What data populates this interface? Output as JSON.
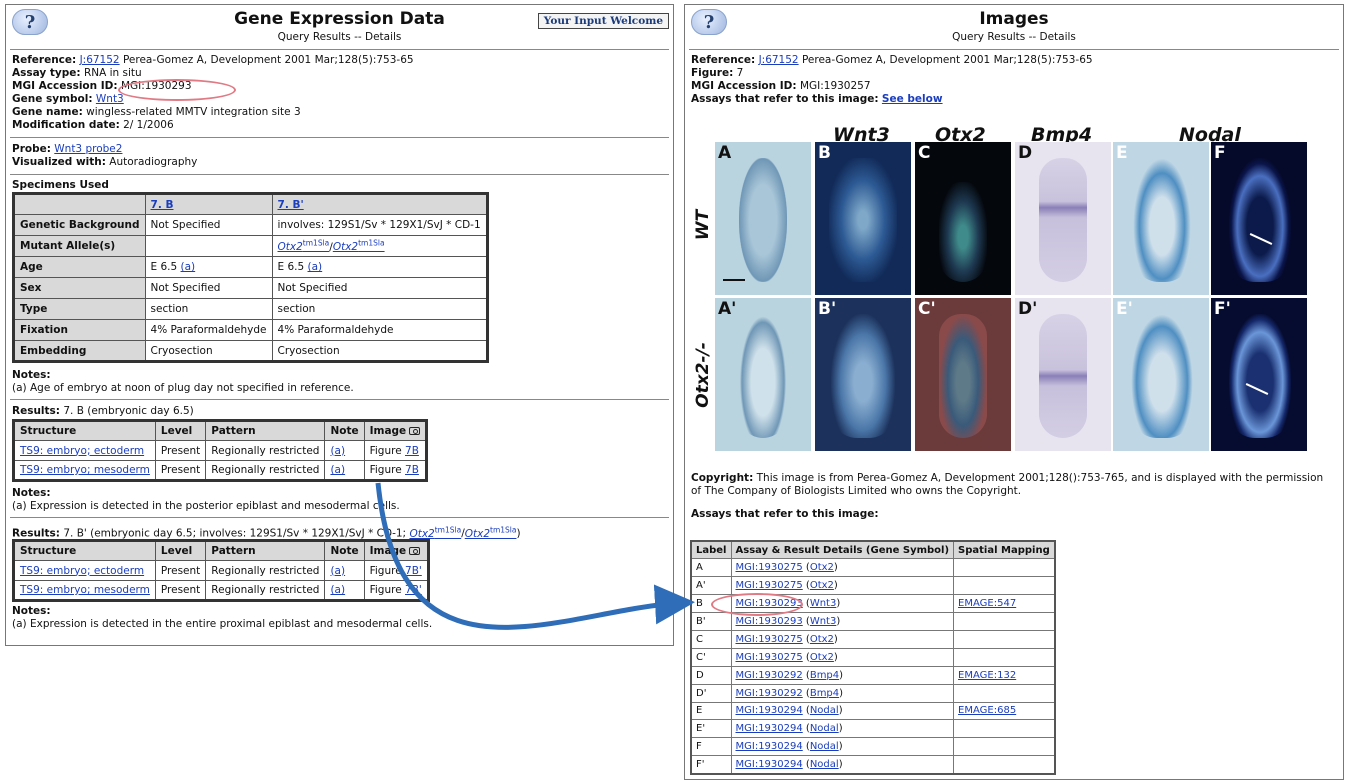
{
  "left": {
    "title": "Gene Expression Data",
    "subtitle": "Query Results -- Details",
    "welcome": "Your Input Welcome",
    "help": "?",
    "reference_label": "Reference:",
    "reference_link": "J:67152",
    "reference_text": "Perea-Gomez A, Development 2001 Mar;128(5):753-65",
    "assay_label": "Assay type:",
    "assay_value": "RNA in situ",
    "accession_label": "MGI Accession ID:",
    "accession_value": "MGI:1930293",
    "symbol_label": "Gene symbol:",
    "symbol_value": "Wnt3",
    "genename_label": "Gene name:",
    "genename_value": "wingless-related MMTV integration site 3",
    "moddate_label": "Modification date:",
    "moddate_value": "2/ 1/2006",
    "probe_label": "Probe:",
    "probe_value": "Wnt3 probe2",
    "visualized_label": "Visualized with:",
    "visualized_value": "Autoradiography",
    "specimens_title": "Specimens Used",
    "specimen_cols": [
      "7. B",
      "7. B'"
    ],
    "specimen_rows": [
      {
        "label": "Genetic Background",
        "a": "Not Specified",
        "b": "involves: 129S1/Sv * 129X1/SvJ * CD-1"
      },
      {
        "label": "Mutant Allele(s)",
        "a": "",
        "b": ""
      },
      {
        "label": "Age",
        "a": "E 6.5",
        "b": "E 6.5"
      },
      {
        "label": "Sex",
        "a": "Not Specified",
        "b": "Not Specified"
      },
      {
        "label": "Type",
        "a": "section",
        "b": "section"
      },
      {
        "label": "Fixation",
        "a": "4% Paraformaldehyde",
        "b": "4% Paraformaldehyde"
      },
      {
        "label": "Embedding",
        "a": "Cryosection",
        "b": "Cryosection"
      }
    ],
    "allele_gene": "Otx2",
    "allele_sup": "tm1Sla",
    "note_link": "(a)",
    "notes_label": "Notes:",
    "note1": "(a) Age of embryo at noon of plug day not specified in reference.",
    "results1_label": "Results:",
    "results1_text": "7. B (embryonic day 6.5)",
    "results_cols": [
      "Structure",
      "Level",
      "Pattern",
      "Note",
      "Image"
    ],
    "results1_rows": [
      {
        "structure": "TS9: embryo; ectoderm",
        "level": "Present",
        "pattern": "Regionally restricted",
        "note": "(a)",
        "fig": "Figure",
        "figlink": "7B"
      },
      {
        "structure": "TS9: embryo; mesoderm",
        "level": "Present",
        "pattern": "Regionally restricted",
        "note": "(a)",
        "fig": "Figure",
        "figlink": "7B"
      }
    ],
    "note2": "(a) Expression is detected in the posterior epiblast and mesodermal cells.",
    "results2_label": "Results:",
    "results2_text": "7. B' (embryonic day 6.5; involves: 129S1/Sv * 129X1/SvJ * CD-1;",
    "results2_rows": [
      {
        "structure": "TS9: embryo; ectoderm",
        "level": "Present",
        "pattern": "Regionally restricted",
        "note": "(a)",
        "fig": "Figure",
        "figlink": "7B'"
      },
      {
        "structure": "TS9: embryo; mesoderm",
        "level": "Present",
        "pattern": "Regionally restricted",
        "note": "(a)",
        "fig": "Figure",
        "figlink": "7B'"
      }
    ],
    "note3": "(a) Expression is detected in the entire proximal epiblast and mesodermal cells."
  },
  "right": {
    "title": "Images",
    "subtitle": "Query Results -- Details",
    "help": "?",
    "reference_label": "Reference:",
    "reference_link": "J:67152",
    "reference_text": "Perea-Gomez A, Development 2001 Mar;128(5):753-65",
    "figure_label": "Figure:",
    "figure_value": "7",
    "accession_label": "MGI Accession ID:",
    "accession_value": "MGI:1930257",
    "assays_label": "Assays that refer to this image:",
    "see_below": "See below",
    "col_headers": [
      "Wnt3",
      "Otx2",
      "Bmp4",
      "Nodal"
    ],
    "row_labels": [
      "WT",
      "Otx2-/-"
    ],
    "panels_top": [
      "A",
      "B",
      "C",
      "D",
      "E",
      "F"
    ],
    "panels_bottom": [
      "A'",
      "B'",
      "C'",
      "D'",
      "E'",
      "F'"
    ],
    "copyright_label": "Copyright:",
    "copyright_text": "This image is from Perea-Gomez A, Development 2001;128():753-765, and is displayed with the permission of The Company of Biologists Limited who owns the Copyright.",
    "assays_title": "Assays that refer to this image:",
    "assay_cols": [
      "Label",
      "Assay & Result Details (Gene Symbol)",
      "Spatial Mapping"
    ],
    "assay_rows": [
      {
        "label": "A",
        "id": "MGI:1930275",
        "gene": "Otx2",
        "map": ""
      },
      {
        "label": "A'",
        "id": "MGI:1930275",
        "gene": "Otx2",
        "map": ""
      },
      {
        "label": "B",
        "id": "MGI:1930293",
        "gene": "Wnt3",
        "map": "EMAGE:547"
      },
      {
        "label": "B'",
        "id": "MGI:1930293",
        "gene": "Wnt3",
        "map": ""
      },
      {
        "label": "C",
        "id": "MGI:1930275",
        "gene": "Otx2",
        "map": ""
      },
      {
        "label": "C'",
        "id": "MGI:1930275",
        "gene": "Otx2",
        "map": ""
      },
      {
        "label": "D",
        "id": "MGI:1930292",
        "gene": "Bmp4",
        "map": "EMAGE:132"
      },
      {
        "label": "D'",
        "id": "MGI:1930292",
        "gene": "Bmp4",
        "map": ""
      },
      {
        "label": "E",
        "id": "MGI:1930294",
        "gene": "Nodal",
        "map": "EMAGE:685"
      },
      {
        "label": "E'",
        "id": "MGI:1930294",
        "gene": "Nodal",
        "map": ""
      },
      {
        "label": "F",
        "id": "MGI:1930294",
        "gene": "Nodal",
        "map": ""
      },
      {
        "label": "F'",
        "id": "MGI:1930294",
        "gene": "Nodal",
        "map": ""
      }
    ]
  },
  "colors": {
    "link": "#1a3dbd",
    "highlight_oval": "#e07a84",
    "arrow": "#2f6db8",
    "header_cell": "#d9d9d9"
  }
}
